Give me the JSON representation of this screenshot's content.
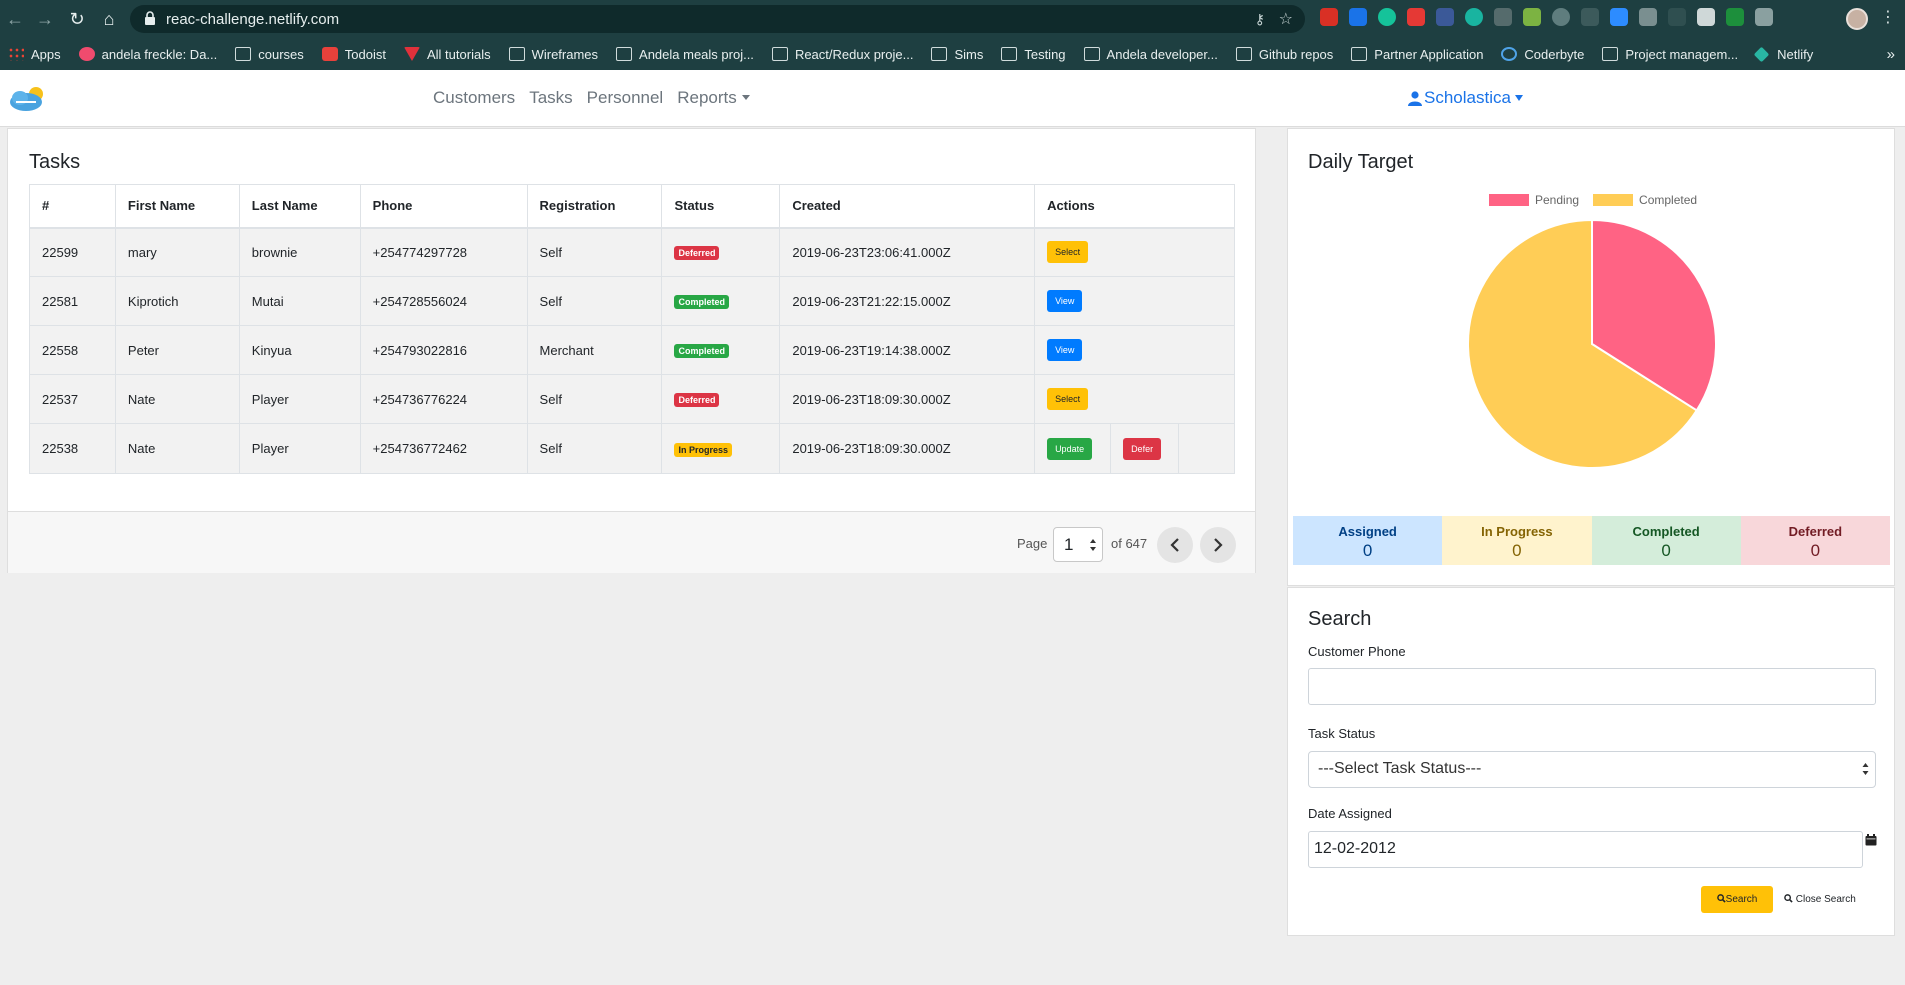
{
  "browser": {
    "url": "reac-challenge.netlify.com",
    "bookmarks": [
      {
        "label": "Apps",
        "icon": "apps"
      },
      {
        "label": "andela freckle: Da...",
        "icon": "pink"
      },
      {
        "label": "courses",
        "icon": "folder"
      },
      {
        "label": "Todoist",
        "icon": "red"
      },
      {
        "label": "All tutorials",
        "icon": "vee"
      },
      {
        "label": "Wireframes",
        "icon": "folder"
      },
      {
        "label": "Andela meals proj...",
        "icon": "folder"
      },
      {
        "label": "React/Redux proje...",
        "icon": "folder"
      },
      {
        "label": "Sims",
        "icon": "folder"
      },
      {
        "label": "Testing",
        "icon": "folder"
      },
      {
        "label": "Andela developer...",
        "icon": "folder"
      },
      {
        "label": "Github repos",
        "icon": "folder"
      },
      {
        "label": "Partner Application",
        "icon": "folder"
      },
      {
        "label": "Coderbyte",
        "icon": "hex"
      },
      {
        "label": "Project managem...",
        "icon": "folder"
      },
      {
        "label": "Netlify",
        "icon": "diamond"
      }
    ],
    "more": "»"
  },
  "nav": {
    "links": [
      "Customers",
      "Tasks",
      "Personnel",
      "Reports"
    ],
    "user": "Scholastica"
  },
  "tasks": {
    "title": "Tasks",
    "headers": [
      "#",
      "First Name",
      "Last Name",
      "Phone",
      "Registration",
      "Status",
      "Created",
      "Actions"
    ],
    "rows": [
      {
        "id": "22599",
        "first": "mary",
        "last": "brownie",
        "phone": "+254774297728",
        "registration": "Self",
        "status": "Deferred",
        "created": "2019-06-23T23:06:41.000Z",
        "actions": [
          "Select"
        ]
      },
      {
        "id": "22581",
        "first": "Kiprotich",
        "last": "Mutai",
        "phone": "+254728556024",
        "registration": "Self",
        "status": "Completed",
        "created": "2019-06-23T21:22:15.000Z",
        "actions": [
          "View"
        ]
      },
      {
        "id": "22558",
        "first": "Peter",
        "last": "Kinyua",
        "phone": "+254793022816",
        "registration": "Merchant",
        "status": "Completed",
        "created": "2019-06-23T19:14:38.000Z",
        "actions": [
          "View"
        ]
      },
      {
        "id": "22537",
        "first": "Nate",
        "last": "Player",
        "phone": "+254736776224",
        "registration": "Self",
        "status": "Deferred",
        "created": "2019-06-23T18:09:30.000Z",
        "actions": [
          "Select"
        ]
      },
      {
        "id": "22538",
        "first": "Nate",
        "last": "Player",
        "phone": "+254736772462",
        "registration": "Self",
        "status": "In Progress",
        "created": "2019-06-23T18:09:30.000Z",
        "actions": [
          "Update",
          "Defer"
        ]
      }
    ],
    "pagination": {
      "page_label": "Page",
      "current_page": "1",
      "of_label": "of 647"
    }
  },
  "daily_target": {
    "title": "Daily Target",
    "legend": [
      {
        "label": "Pending",
        "color": "#ff6384"
      },
      {
        "label": "Completed",
        "color": "#ffcd56"
      }
    ],
    "stats": [
      {
        "label": "Assigned",
        "value": "0",
        "bg": "#cce5ff",
        "color": "#004085"
      },
      {
        "label": "In Progress",
        "value": "0",
        "bg": "#fff3cd",
        "color": "#856404"
      },
      {
        "label": "Completed",
        "value": "0",
        "bg": "#d4edda",
        "color": "#155724"
      },
      {
        "label": "Deferred",
        "value": "0",
        "bg": "#f8d7da",
        "color": "#721c24"
      }
    ]
  },
  "chart_data": {
    "type": "pie",
    "categories": [
      "Pending",
      "Completed"
    ],
    "values": [
      34,
      66
    ],
    "colors": [
      "#ff6384",
      "#ffcd56"
    ],
    "legend_position": "top"
  },
  "search": {
    "title": "Search",
    "phone_label": "Customer Phone",
    "phone_value": "",
    "status_label": "Task Status",
    "status_value": "---Select Task Status---",
    "date_label": "Date Assigned",
    "date_value": "12-02-2012",
    "search_button": "Search",
    "close_button": "Close Search"
  }
}
